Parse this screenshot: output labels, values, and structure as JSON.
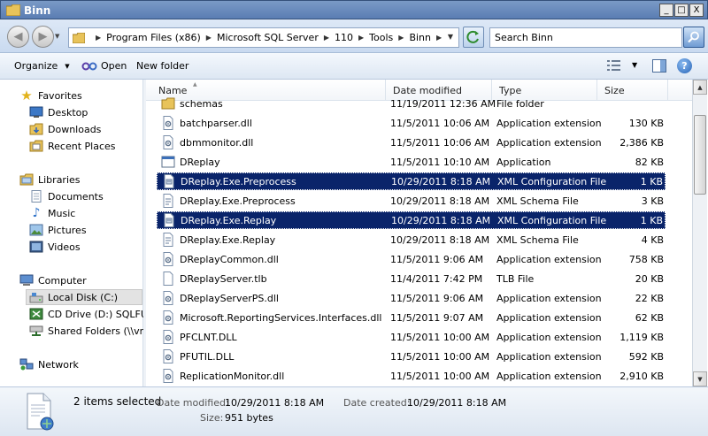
{
  "window": {
    "title": "Binn"
  },
  "window_buttons": {
    "minimize": "_",
    "maximize": "□",
    "close": "X"
  },
  "address": {
    "crumbs": [
      "Program Files (x86)",
      "Microsoft SQL Server",
      "110",
      "Tools",
      "Binn"
    ]
  },
  "search": {
    "placeholder": "Search Binn"
  },
  "toolbar": {
    "organize": "Organize",
    "open": "Open",
    "new_folder": "New folder"
  },
  "nav": {
    "favorites": "Favorites",
    "desktop": "Desktop",
    "downloads": "Downloads",
    "recent": "Recent Places",
    "libraries": "Libraries",
    "documents": "Documents",
    "music": "Music",
    "pictures": "Pictures",
    "videos": "Videos",
    "computer": "Computer",
    "local_disk": "Local Disk (C:)",
    "cd_drive": "CD Drive (D:) SQLFULL",
    "shared": "Shared Folders (\\\\vmw",
    "network": "Network"
  },
  "columns": {
    "name": "Name",
    "date": "Date modified",
    "type": "Type",
    "size": "Size"
  },
  "files": [
    {
      "name": "schemas",
      "date": "11/19/2011 12:36 AM",
      "type": "File folder",
      "size": "",
      "icon": "folder-icon",
      "selected": false
    },
    {
      "name": "batchparser.dll",
      "date": "11/5/2011 10:06 AM",
      "type": "Application extension",
      "size": "130 KB",
      "icon": "dll-icon",
      "selected": false
    },
    {
      "name": "dbmmonitor.dll",
      "date": "11/5/2011 10:06 AM",
      "type": "Application extension",
      "size": "2,386 KB",
      "icon": "dll-icon",
      "selected": false
    },
    {
      "name": "DReplay",
      "date": "11/5/2011 10:10 AM",
      "type": "Application",
      "size": "82 KB",
      "icon": "exe-icon",
      "selected": false
    },
    {
      "name": "DReplay.Exe.Preprocess",
      "date": "10/29/2011 8:18 AM",
      "type": "XML Configuration File",
      "size": "1 KB",
      "icon": "config-icon",
      "selected": true
    },
    {
      "name": "DReplay.Exe.Preprocess",
      "date": "10/29/2011 8:18 AM",
      "type": "XML Schema File",
      "size": "3 KB",
      "icon": "xsd-icon",
      "selected": false
    },
    {
      "name": "DReplay.Exe.Replay",
      "date": "10/29/2011 8:18 AM",
      "type": "XML Configuration File",
      "size": "1 KB",
      "icon": "config-icon",
      "selected": true
    },
    {
      "name": "DReplay.Exe.Replay",
      "date": "10/29/2011 8:18 AM",
      "type": "XML Schema File",
      "size": "4 KB",
      "icon": "xsd-icon",
      "selected": false
    },
    {
      "name": "DReplayCommon.dll",
      "date": "11/5/2011 9:06 AM",
      "type": "Application extension",
      "size": "758 KB",
      "icon": "dll-icon",
      "selected": false
    },
    {
      "name": "DReplayServer.tlb",
      "date": "11/4/2011 7:42 PM",
      "type": "TLB File",
      "size": "20 KB",
      "icon": "blank-file-icon",
      "selected": false
    },
    {
      "name": "DReplayServerPS.dll",
      "date": "11/5/2011 9:06 AM",
      "type": "Application extension",
      "size": "22 KB",
      "icon": "dll-icon",
      "selected": false
    },
    {
      "name": "Microsoft.ReportingServices.Interfaces.dll",
      "date": "11/5/2011 9:07 AM",
      "type": "Application extension",
      "size": "62 KB",
      "icon": "dll-icon",
      "selected": false
    },
    {
      "name": "PFCLNT.DLL",
      "date": "11/5/2011 10:00 AM",
      "type": "Application extension",
      "size": "1,119 KB",
      "icon": "dll-icon",
      "selected": false
    },
    {
      "name": "PFUTIL.DLL",
      "date": "11/5/2011 10:00 AM",
      "type": "Application extension",
      "size": "592 KB",
      "icon": "dll-icon",
      "selected": false
    },
    {
      "name": "ReplicationMonitor.dll",
      "date": "11/5/2011 10:00 AM",
      "type": "Application extension",
      "size": "2,910 KB",
      "icon": "dll-icon",
      "selected": false
    }
  ],
  "details": {
    "title": "2 items selected",
    "date_modified_label": "Date modified:",
    "date_modified": "10/29/2011 8:18 AM",
    "date_created_label": "Date created:",
    "date_created": "10/29/2011 8:18 AM",
    "size_label": "Size:",
    "size": "951 bytes"
  },
  "colors": {
    "selection": "#0a246a",
    "titlebar": "#5a7db3"
  }
}
